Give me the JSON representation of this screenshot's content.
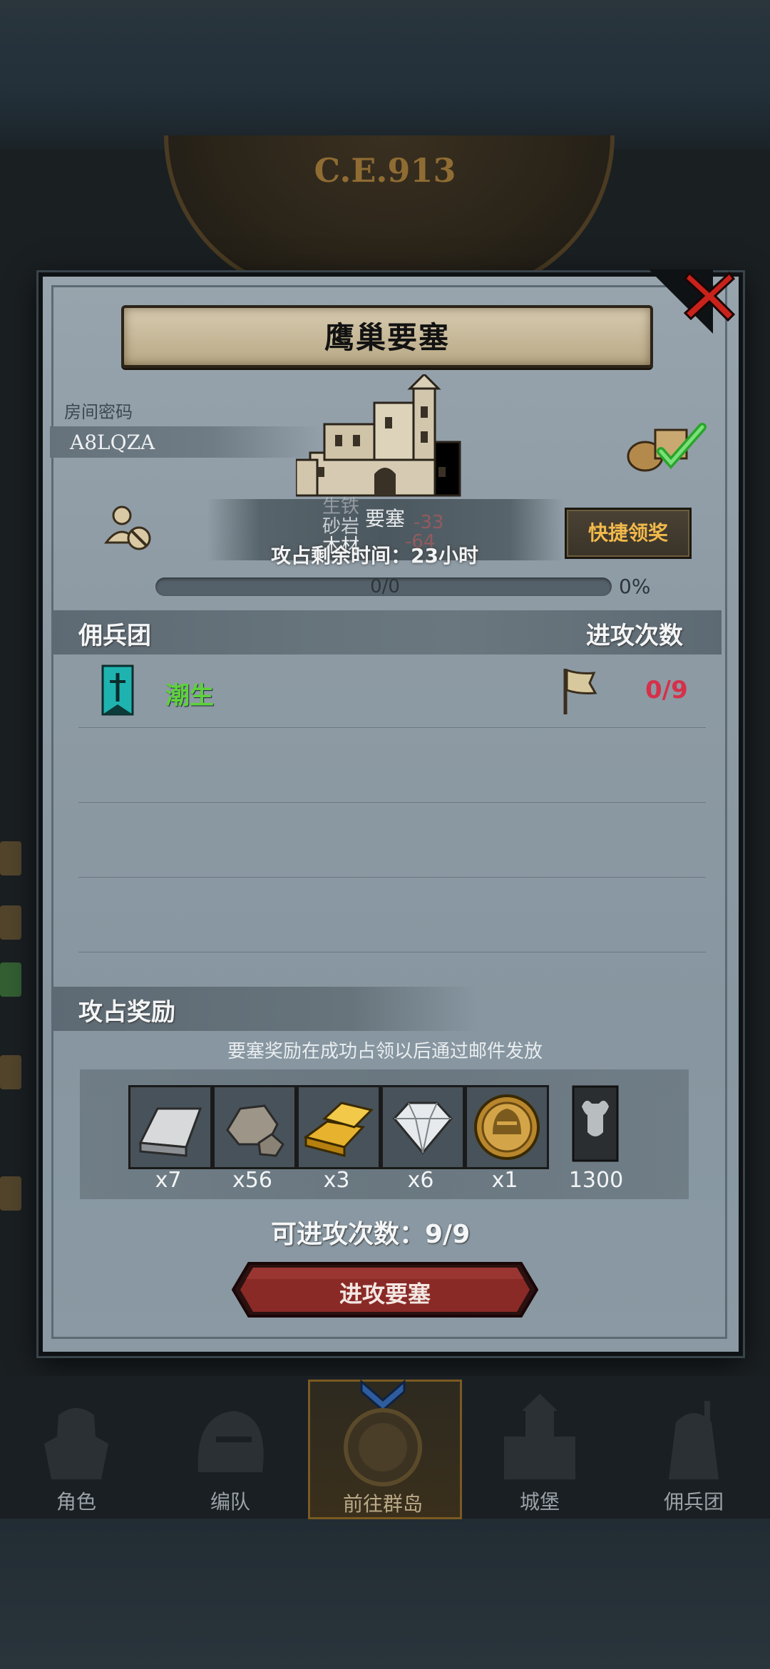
{
  "background": {
    "era_label": "C.E.913"
  },
  "dialog": {
    "title": "鹰巢要塞",
    "close_icon": "close-x-icon",
    "room_code_label": "房间密码",
    "room_code": "A8LQZA",
    "fortress_info": {
      "line1": "生铁",
      "line2": "砂岩",
      "line2_value": "-33",
      "line3": "木材",
      "line3_value": "-64",
      "overlay_label": "要塞"
    },
    "quick_claim_button": "快捷领奖",
    "timer_text": "攻占剩余时间：23小时",
    "progress": {
      "text": "0/0",
      "percent_label": "0%",
      "fraction": 0
    },
    "mercenary_section": {
      "title": "佣兵团",
      "attack_count_header": "进攻次数",
      "rows": [
        {
          "name": "潮生",
          "attacks": "0/9"
        }
      ]
    },
    "reward_section": {
      "title": "攻占奖励",
      "note": "要塞奖励在成功占领以后通过邮件发放",
      "items": [
        {
          "icon": "iron-ingot-icon",
          "qty": "x7"
        },
        {
          "icon": "stone-ore-icon",
          "qty": "x56"
        },
        {
          "icon": "gold-bars-icon",
          "qty": "x3"
        },
        {
          "icon": "diamond-icon",
          "qty": "x6"
        },
        {
          "icon": "knight-helmet-coin-icon",
          "qty": "x1"
        },
        {
          "icon": "bull-banner-icon",
          "qty": "1300"
        }
      ]
    },
    "attempts_text": "可进攻次数：9/9",
    "attack_button": "进攻要塞"
  },
  "bottom_nav": [
    {
      "label": "角色",
      "icon": "knight-icon"
    },
    {
      "label": "编队",
      "icon": "helmet-icon"
    },
    {
      "label": "前往群岛",
      "icon": "compass-icon",
      "active": true
    },
    {
      "label": "城堡",
      "icon": "castle-icon"
    },
    {
      "label": "佣兵团",
      "icon": "mercenary-icon"
    }
  ],
  "colors": {
    "accent_gold": "#f0b94b",
    "merc_name_green": "#5ed23a",
    "attack_count_red": "#d6304a",
    "close_red": "#c9221b",
    "attack_button_red": "#8a2a26"
  }
}
